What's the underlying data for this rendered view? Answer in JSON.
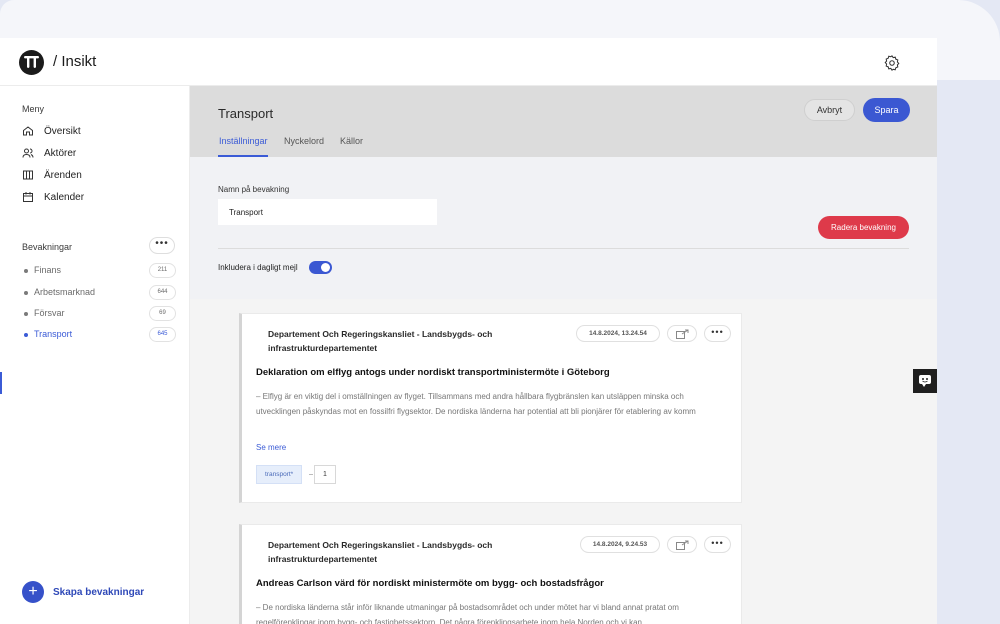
{
  "app": {
    "title": "/ Insikt"
  },
  "sidebar": {
    "menu_heading": "Meny",
    "items": [
      {
        "label": "Översikt",
        "icon": "home-icon"
      },
      {
        "label": "Aktörer",
        "icon": "users-icon"
      },
      {
        "label": "Ärenden",
        "icon": "columns-icon"
      },
      {
        "label": "Kalender",
        "icon": "calendar-icon"
      }
    ],
    "bevakningar_heading": "Bevakningar",
    "bevakningar": [
      {
        "label": "Finans",
        "count": "211"
      },
      {
        "label": "Arbetsmarknad",
        "count": "644"
      },
      {
        "label": "Försvar",
        "count": "69"
      },
      {
        "label": "Transport",
        "count": "645",
        "active": true
      }
    ],
    "create_label": "Skapa bevakningar"
  },
  "header": {
    "title": "Transport",
    "tabs": [
      "Inställningar",
      "Nyckelord",
      "Källor"
    ],
    "active_tab": "Inställningar",
    "cancel_label": "Avbryt",
    "save_label": "Spara"
  },
  "settings": {
    "name_label": "Namn på bevakning",
    "name_value": "Transport",
    "delete_label": "Radera bevakning",
    "toggle_label": "Inkludera i dagligt mejl",
    "toggle_on": true
  },
  "feed": [
    {
      "source": "Departement Och Regeringskansliet - Landsbygds- och infrastrukturdepartementet",
      "date": "14.8.2024, 13.24.54",
      "title": "Deklaration om elflyg antogs under nordiskt transportministermöte i Göteborg",
      "excerpt": "– Elflyg är en viktig del i omställningen av flyget. Tillsammans med andra hållbara flygbränslen kan utsläppen minska och utvecklingen påskyndas mot en fossilfri flygsektor. De nordiska länderna har potential att bli pionjärer för etablering av komm",
      "see_more": "Se mere",
      "tag": "transport*",
      "tag_count": "1"
    },
    {
      "source": "Departement Och Regeringskansliet - Landsbygds- och infrastrukturdepartementet",
      "date": "14.8.2024, 9.24.53",
      "title": "Andreas Carlson värd för nordiskt ministermöte om bygg- och bostadsfrågor",
      "excerpt": "– De nordiska länderna står inför liknande utmaningar på bostadsområdet och under mötet har vi bland annat pratat om regelförenklingar inom bygg- och fastighetssektorn. Det några förenklingsarbete inom hela Norden och vi kan"
    }
  ],
  "colors": {
    "accent": "#3b58d2",
    "danger": "#de3a4a"
  }
}
